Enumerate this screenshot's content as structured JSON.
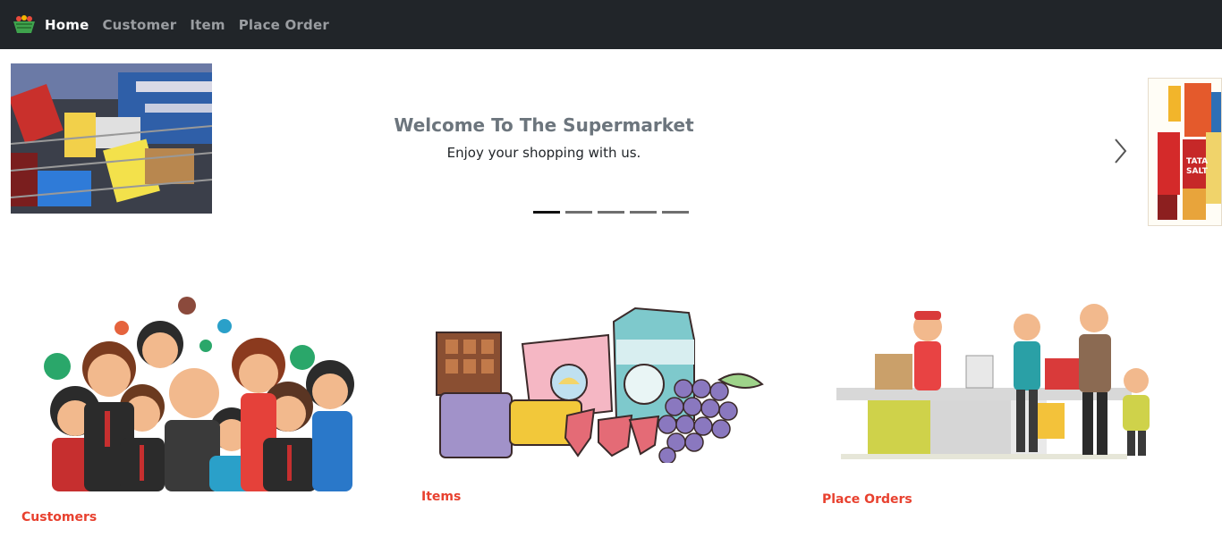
{
  "navbar": {
    "brand_icon": "basket-logo-icon",
    "links": [
      {
        "label": "Home",
        "active": true
      },
      {
        "label": "Customer",
        "active": false
      },
      {
        "label": "Item",
        "active": false
      },
      {
        "label": "Place Order",
        "active": false
      }
    ]
  },
  "carousel": {
    "title": "Welcome To The Supermarket",
    "subtitle": "Enjoy your shopping with us.",
    "indicator_count": 5,
    "active_indicator": 1,
    "next_icon": "chevron-right-icon"
  },
  "cards": {
    "customers_label": "Customers",
    "items_label": "Items",
    "orders_label": "Place Orders"
  },
  "colors": {
    "navbar_bg": "#212529",
    "nav_active": "#ffffff",
    "nav_inactive": "#9a9da1",
    "card_label": "#e8412f"
  }
}
